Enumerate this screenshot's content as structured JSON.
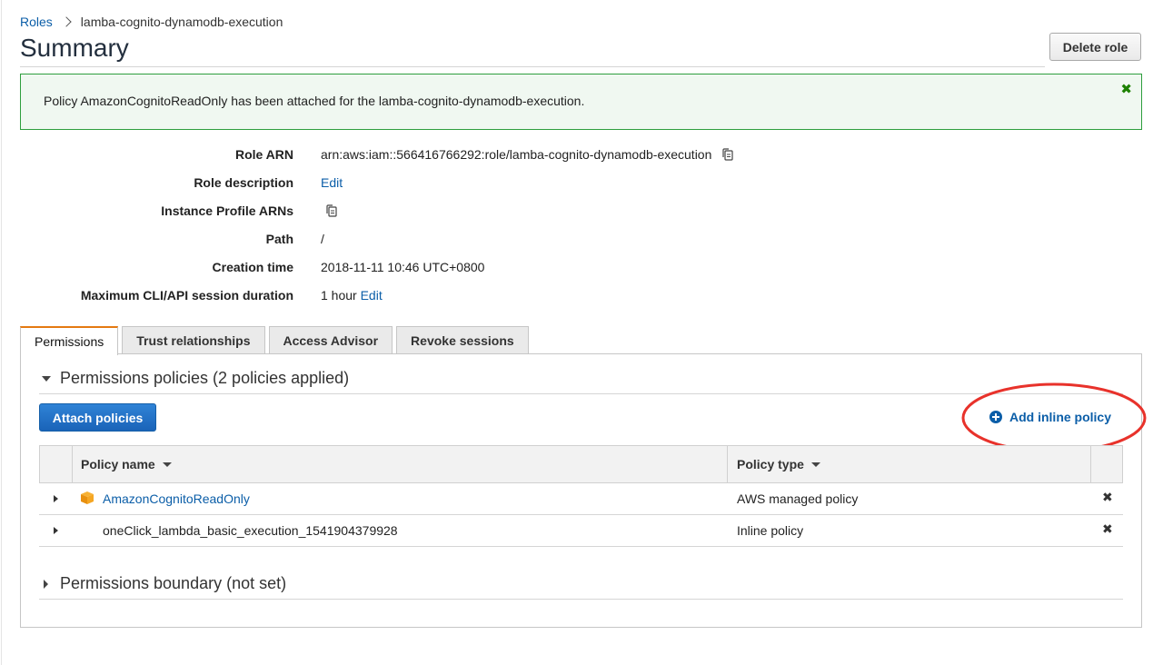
{
  "breadcrumb": {
    "parent": "Roles",
    "current": "lamba-cognito-dynamodb-execution"
  },
  "page": {
    "title": "Summary",
    "delete_button": "Delete role"
  },
  "banner": {
    "message": "Policy AmazonCognitoReadOnly has been attached for the lamba-cognito-dynamodb-execution.",
    "close_icon": "close-icon",
    "color": "#2e9e3e"
  },
  "details": {
    "role_arn": {
      "label": "Role ARN",
      "value": "arn:aws:iam::566416766292:role/lamba-cognito-dynamodb-execution"
    },
    "role_description": {
      "label": "Role description",
      "edit": "Edit"
    },
    "instance_profile": {
      "label": "Instance Profile ARNs"
    },
    "path": {
      "label": "Path",
      "value": "/"
    },
    "creation_time": {
      "label": "Creation time",
      "value": "2018-11-11 10:46 UTC+0800"
    },
    "max_session": {
      "label": "Maximum CLI/API session duration",
      "value": "1 hour",
      "edit": "Edit"
    }
  },
  "tabs": [
    {
      "label": "Permissions",
      "active": true
    },
    {
      "label": "Trust relationships"
    },
    {
      "label": "Access Advisor"
    },
    {
      "label": "Revoke sessions"
    }
  ],
  "permissions": {
    "policies_header": "Permissions policies (2 policies applied)",
    "attach_button": "Attach policies",
    "add_inline": "Add inline policy",
    "columns": {
      "name": "Policy name",
      "type": "Policy type"
    },
    "rows": [
      {
        "name": "AmazonCognitoReadOnly",
        "type": "AWS managed policy",
        "managed": true
      },
      {
        "name": "oneClick_lambda_basic_execution_1541904379928",
        "type": "Inline policy",
        "managed": false
      }
    ],
    "boundary_header": "Permissions boundary (not set)"
  },
  "colors": {
    "link": "#0b5ea8",
    "accent_tab": "#e47911",
    "primary_button": "#1a63b8",
    "annotation": "#e8322b"
  }
}
